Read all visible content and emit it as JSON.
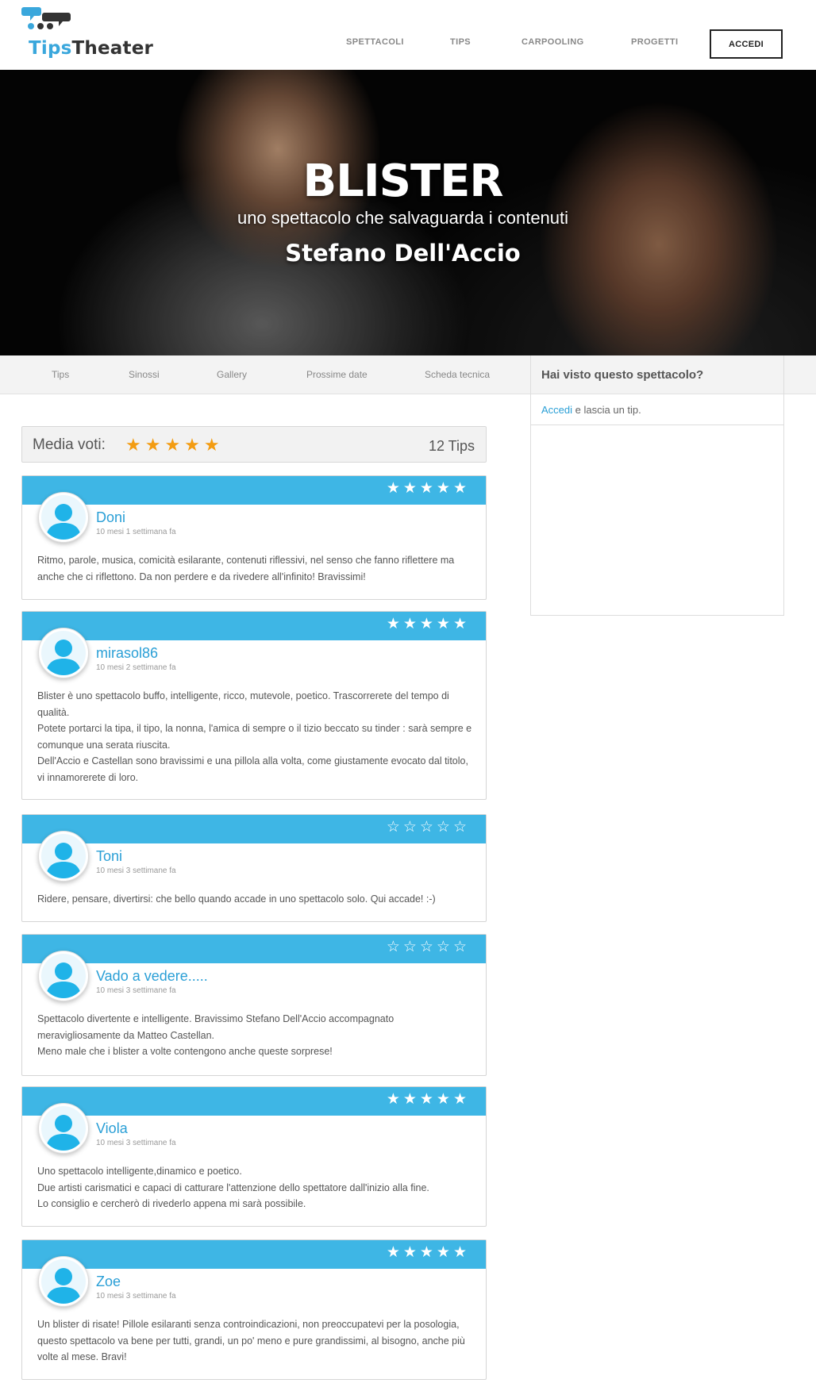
{
  "header": {
    "logo": {
      "part1": "Tips",
      "part2": "Theater"
    },
    "nav": [
      {
        "label": "SPETTACOLI"
      },
      {
        "label": "TIPS"
      },
      {
        "label": "CARPOOLING"
      },
      {
        "label": "PROGETTI"
      }
    ],
    "login_button": "ACCEDI"
  },
  "hero": {
    "title": "BLISTER",
    "subtitle": "uno spettacolo che salvaguarda i contenuti",
    "author": "Stefano Dell'Accio"
  },
  "tabs": [
    {
      "label": "Tips"
    },
    {
      "label": "Sinossi"
    },
    {
      "label": "Gallery"
    },
    {
      "label": "Prossime date"
    },
    {
      "label": "Scheda tecnica"
    }
  ],
  "sidebar": {
    "title": "Hai visto questo spettacolo?",
    "link": "Accedi",
    "text": " e lascia un tip."
  },
  "rating": {
    "label": "Media voti:",
    "stars": "★★★★★",
    "stars_value": 5,
    "count": "12 Tips"
  },
  "reviews": [
    {
      "user": "Doni",
      "time": "10 mesi 1 settimana fa",
      "stars": "★★★★★",
      "rating": 5,
      "lines": [
        "Ritmo, parole, musica, comicità esilarante, contenuti riflessivi, nel senso che fanno riflettere ma anche che ci riflettono. Da non perdere e da rivedere all'infinito! Bravissimi!"
      ]
    },
    {
      "user": "mirasol86",
      "time": "10 mesi 2 settimane fa",
      "stars": "★★★★★",
      "rating": 5,
      "lines": [
        "Blister è uno spettacolo buffo, intelligente, ricco, mutevole, poetico. Trascorrerete del tempo di qualità.",
        "Potete portarci la tipa, il tipo, la nonna, l'amica di sempre o il tizio beccato su tinder : sarà sempre e comunque una serata riuscita.",
        "Dell'Accio e Castellan sono bravissimi e una pillola alla volta, come giustamente evocato dal titolo, vi innamorerete di loro."
      ]
    },
    {
      "user": "Toni",
      "time": "10 mesi 3 settimane fa",
      "stars": "☆☆☆☆☆",
      "rating": 0,
      "lines": [
        "Ridere, pensare, divertirsi: che bello quando accade in uno spettacolo solo. Qui accade! :-)"
      ]
    },
    {
      "user": "Vado a vedere.....",
      "time": "10 mesi 3 settimane fa",
      "stars": "☆☆☆☆☆",
      "rating": 0,
      "lines": [
        "Spettacolo divertente e intelligente. Bravissimo Stefano Dell'Accio accompagnato meravigliosamente da Matteo Castellan.",
        "Meno male che i blister a volte contengono anche queste sorprese!"
      ]
    },
    {
      "user": "Viola",
      "time": "10 mesi 3 settimane fa",
      "stars": "★★★★★",
      "rating": 5,
      "lines": [
        "Uno spettacolo intelligente,dinamico e poetico.",
        "Due artisti carismatici e capaci di catturare l'attenzione dello spettatore dall'inizio alla fine.",
        "Lo consiglio e cercherò di rivederlo appena mi sarà possibile."
      ]
    },
    {
      "user": "Zoe",
      "time": "10 mesi 3 settimane fa",
      "stars": "★★★★★",
      "rating": 5,
      "lines": [
        "Un blister di risate! Pillole esilaranti senza controindicazioni, non preoccupatevi per la posologia, questo spettacolo va bene per tutti, grandi, un po' meno e pure grandissimi, al bisogno, anche più volte al mese. Bravi!"
      ]
    }
  ],
  "colors": {
    "accent": "#3eb6e5",
    "link": "#2a9fd6",
    "star_avg": "#f39c12"
  }
}
